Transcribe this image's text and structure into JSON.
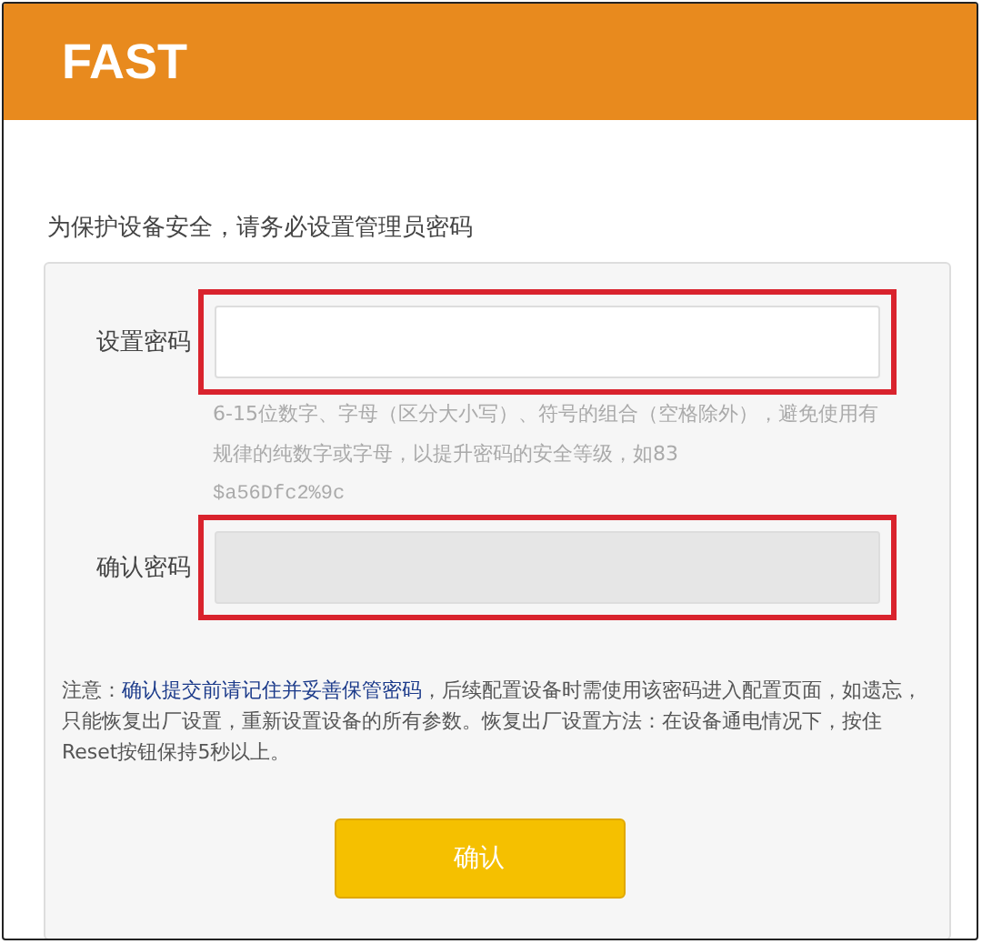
{
  "header": {
    "logo": "FAST"
  },
  "intro": "为保护设备安全，请务必设置管理员密码",
  "fields": [
    {
      "label": "设置密码",
      "disabled": false,
      "highlighted": true,
      "hint": [
        "6-15位数字、字母（区分大小写）、符号的组合（空格除外），避免使用有规律的纯数字或字母，以提升密码的安全等级，如83",
        "$a56Dfc2%9c"
      ]
    },
    {
      "label": "确认密码",
      "disabled": true,
      "highlighted": true
    }
  ],
  "note": {
    "prefix": "注意：",
    "emphasis": "确认提交前请记住并妥善保管密码",
    "text": "，后续配置设备时需使用该密码进入配置页面，如遗忘，只能恢复出厂设置，重新设置设备的所有参数。恢复出厂设置方法：在设备通电情况下，按住Reset按钮保持5秒以上。"
  },
  "button": "确认"
}
